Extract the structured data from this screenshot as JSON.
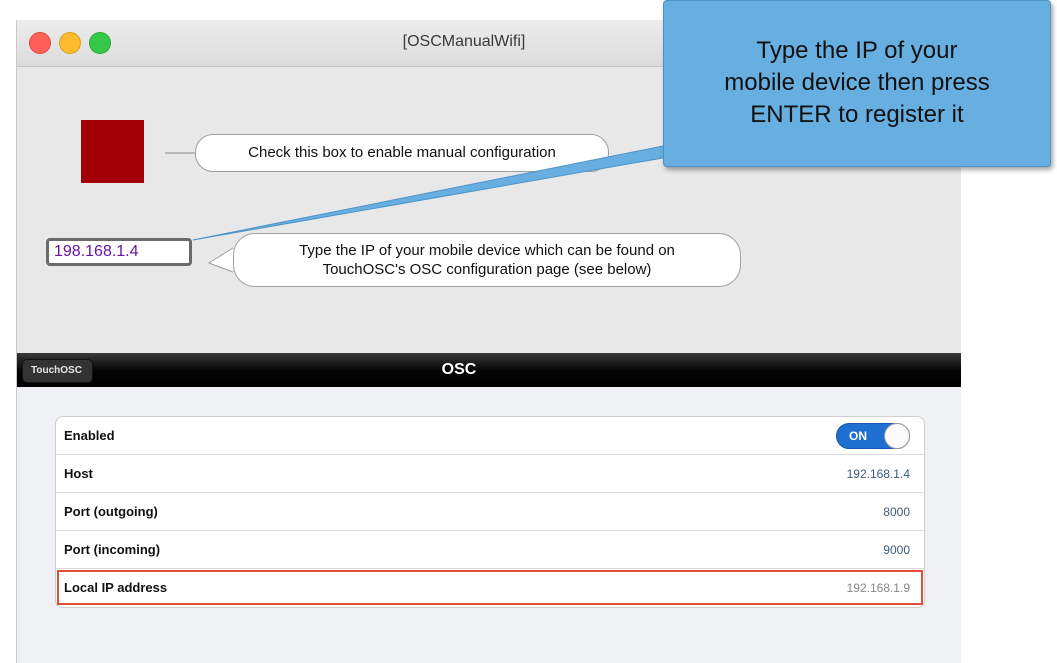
{
  "window": {
    "title": "[OSCManualWifi]"
  },
  "sketch": {
    "checkbox_bubble": "Check this box to enable manual configuration",
    "ip_value": "198.168.1.4",
    "ip_bubble_line1": "Type the IP of your mobile device which can be found on",
    "ip_bubble_line2": "TouchOSC's OSC configuration page (see below)",
    "checkbox_color": "#a10006"
  },
  "touchosc": {
    "back_label": "TouchOSC",
    "title": "OSC",
    "rows": [
      {
        "label": "Enabled",
        "value": "ON"
      },
      {
        "label": "Host",
        "value": "192.168.1.4"
      },
      {
        "label": "Port (outgoing)",
        "value": "8000"
      },
      {
        "label": "Port (incoming)",
        "value": "9000"
      },
      {
        "label": "Local IP address",
        "value": "192.168.1.9"
      }
    ]
  },
  "callout": {
    "line1": "Type the IP of your",
    "line2": "mobile device then press",
    "line3": "ENTER to register it",
    "color": "#67afe0"
  }
}
